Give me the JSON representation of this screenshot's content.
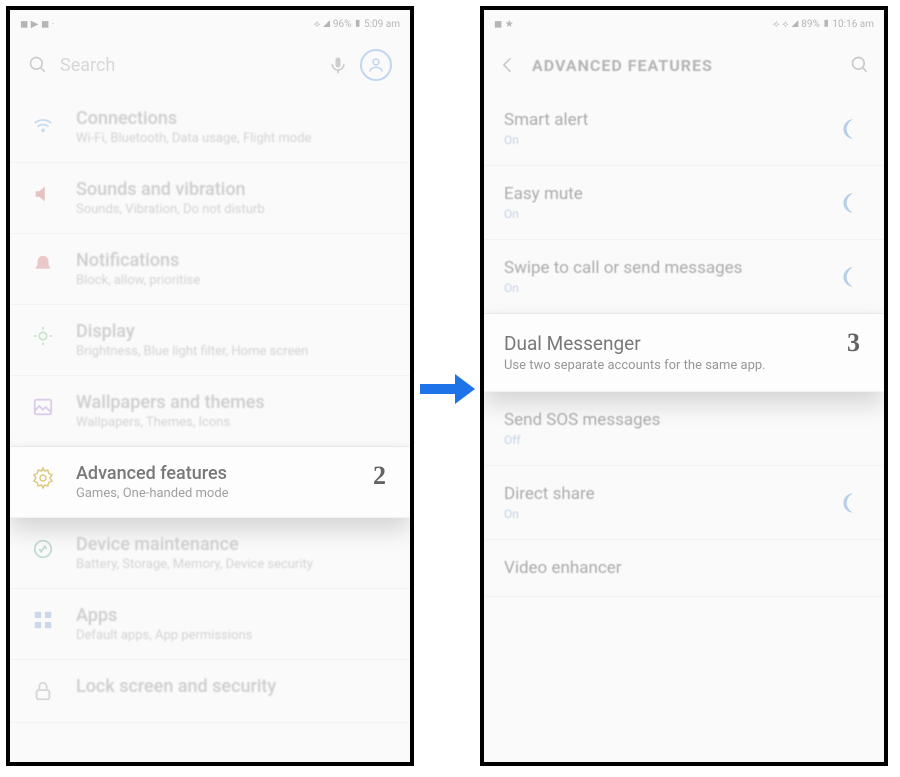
{
  "left": {
    "statusbar": {
      "left_icons": "◼ ▶ ◼ ·",
      "right": "⟡ ◢ 96% ▮ 5:09 am"
    },
    "search": {
      "placeholder": "Search"
    },
    "items": [
      {
        "title": "Connections",
        "sub": "Wi-Fi, Bluetooth, Data usage, Flight mode",
        "icon": "signal-icon"
      },
      {
        "title": "Sounds and vibration",
        "sub": "Sounds, Vibration, Do not disturb",
        "icon": "volume-icon"
      },
      {
        "title": "Notifications",
        "sub": "Block, allow, prioritise",
        "icon": "bell-icon"
      },
      {
        "title": "Display",
        "sub": "Brightness, Blue light filter, Home screen",
        "icon": "sun-icon"
      },
      {
        "title": "Wallpapers and themes",
        "sub": "Wallpapers, Themes, Icons",
        "icon": "picture-icon"
      },
      {
        "title": "Advanced features",
        "sub": "Games, One-handed mode",
        "icon": "gear-icon",
        "highlight": true,
        "step": "2"
      },
      {
        "title": "Device maintenance",
        "sub": "Battery, Storage, Memory, Device security",
        "icon": "health-icon"
      },
      {
        "title": "Apps",
        "sub": "Default apps, App permissions",
        "icon": "grid-icon"
      },
      {
        "title": "Lock screen and security",
        "sub": "",
        "icon": "lock-icon"
      }
    ]
  },
  "right": {
    "statusbar": {
      "left_icons": "◼ ★",
      "right": "⟡ ⟡ ◢ 89% ▮ 10:16 am"
    },
    "header": {
      "title": "ADVANCED FEATURES"
    },
    "items": [
      {
        "title": "Smart alert",
        "sub": "On",
        "toggle": true
      },
      {
        "title": "Easy mute",
        "sub": "On",
        "toggle": true
      },
      {
        "title": "Swipe to call or send messages",
        "sub": "On",
        "toggle": true
      },
      {
        "title": "Dual Messenger",
        "sub": "Use two separate accounts for the same app.",
        "highlight": true,
        "step": "3"
      },
      {
        "title": "Send SOS messages",
        "sub": "Off",
        "toggle": false
      },
      {
        "title": "Direct share",
        "sub": "On",
        "toggle": true
      },
      {
        "title": "Video enhancer",
        "sub": "",
        "toggle": false
      }
    ]
  }
}
